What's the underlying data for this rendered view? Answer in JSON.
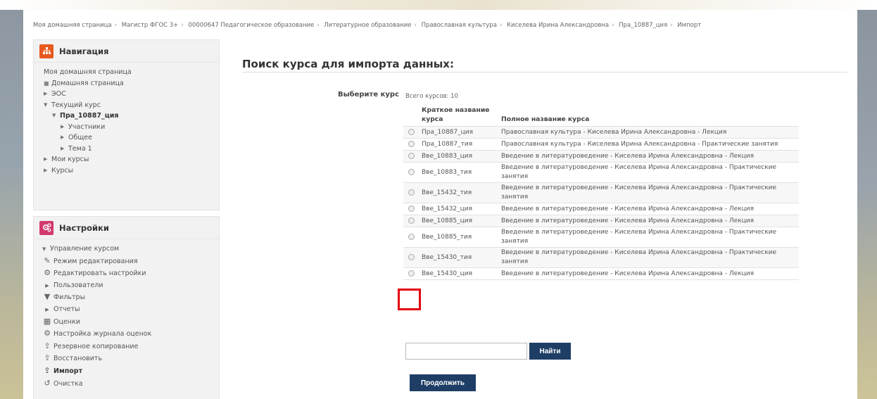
{
  "breadcrumb": [
    "Моя домашняя страница",
    "Магистр ФГОС 3+",
    "00000647 Педагогическое образование",
    "Литературное образование",
    "Православная культура",
    "Киселева Ирина Александровна",
    "Пра_10887_ция",
    "Импорт"
  ],
  "nav": {
    "title": "Навигация",
    "home": "Моя домашняя страница",
    "dashboard": "Домашняя страница",
    "eos": "ЭОС",
    "current_course": "Текущий курс",
    "course_name": "Пра_10887_ция",
    "participants": "Участники",
    "general": "Общее",
    "topic1": "Тема 1",
    "my_courses": "Мои курсы",
    "courses": "Курсы"
  },
  "settings": {
    "title": "Настройки",
    "manage": "Управление курсом",
    "edit_mode": "Режим редактирования",
    "edit_settings": "Редактировать настройки",
    "users": "Пользователи",
    "filters": "Фильтры",
    "reports": "Отчеты",
    "grades": "Оценки",
    "gradebook_setup": "Настройка журнала оценок",
    "backup": "Резервное копирование",
    "restore": "Восстановить",
    "import": "Импорт",
    "reset": "Очистка"
  },
  "main": {
    "title": "Поиск курса для импорта данных:",
    "choose_label": "Выберите курс",
    "total": "Всего курсов: 10",
    "col_short": "Краткое название курса",
    "col_full": "Полное название курса",
    "rows": [
      {
        "short": "Пра_10887_ция",
        "full": "Православная культура - Киселева Ирина Александровна - Лекция"
      },
      {
        "short": "Пра_10887_тия",
        "full": "Православная культура - Киселева Ирина Александровна - Практические занятия"
      },
      {
        "short": "Вве_10883_ция",
        "full": "Введение в литературоведение - Киселева Ирина Александровна - Лекция"
      },
      {
        "short": "Вве_10883_тия",
        "full": "Введение в литературоведение - Киселева Ирина Александровна - Практические занятия"
      },
      {
        "short": "Вве_15432_тия",
        "full": "Введение в литературоведение - Киселева Ирина Александровна - Практические занятия"
      },
      {
        "short": "Вве_15432_ция",
        "full": "Введение в литературоведение - Киселева Ирина Александровна - Лекция"
      },
      {
        "short": "Вве_10885_ция",
        "full": "Введение в литературоведение - Киселева Ирина Александровна - Лекция"
      },
      {
        "short": "Вве_10885_тия",
        "full": "Введение в литературоведение - Киселева Ирина Александровна - Практические занятия"
      },
      {
        "short": "Вве_15430_тия",
        "full": "Введение в литературоведение - Киселева Ирина Александровна - Практические занятия"
      },
      {
        "short": "Вве_15430_ция",
        "full": "Введение в литературоведение - Киселева Ирина Александровна - Лекция"
      }
    ],
    "search_value": "",
    "find_label": "Найти",
    "continue_label": "Продолжить"
  },
  "colors": {
    "button": "#1f3e66",
    "highlight": "#e3000f",
    "nav_icon": "#e8591f",
    "settings_icon": "#d2396c"
  },
  "icons": {
    "nav": "sitemap-icon",
    "settings": "gears-icon"
  }
}
